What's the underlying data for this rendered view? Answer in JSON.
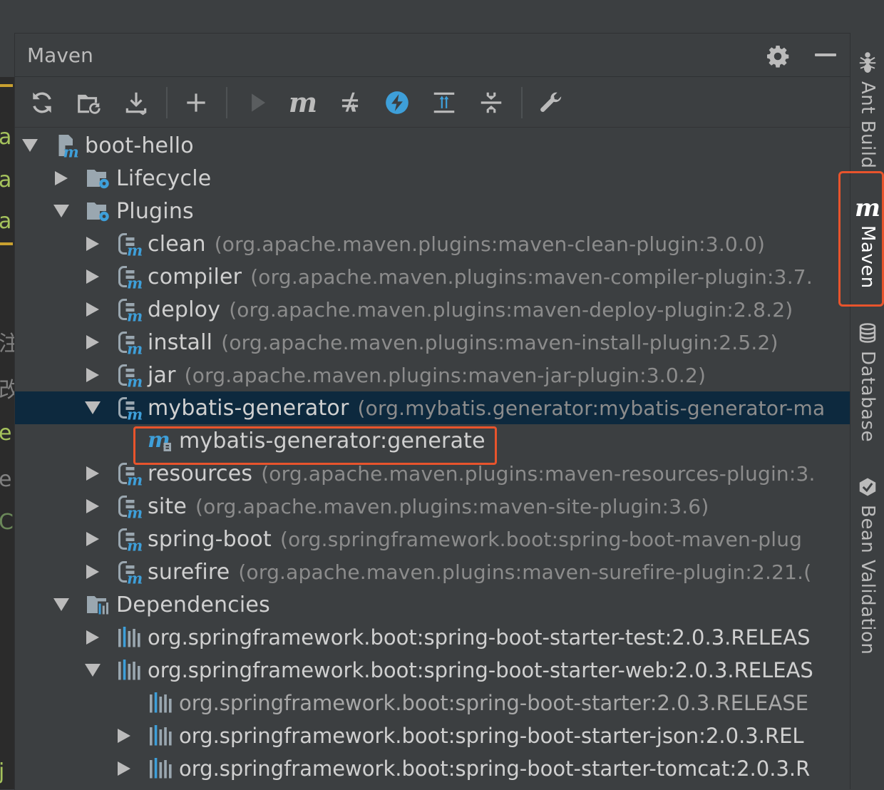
{
  "panel": {
    "title": "Maven"
  },
  "toolbar": {
    "buttons": [
      {
        "name": "reimport-icon"
      },
      {
        "name": "generate-sources-icon"
      },
      {
        "name": "download-icon"
      },
      {
        "name": "add-project-icon"
      },
      {
        "name": "run-icon"
      },
      {
        "name": "execute-goal-icon"
      },
      {
        "name": "toggle-offline-icon"
      },
      {
        "name": "skip-tests-icon"
      },
      {
        "name": "show-dependencies-icon"
      },
      {
        "name": "collapse-all-icon"
      },
      {
        "name": "settings-wrench-icon"
      }
    ],
    "execute_goal_glyph": "m"
  },
  "tree": {
    "root": "boot-hello",
    "lifecycle": "Lifecycle",
    "plugins_label": "Plugins",
    "plugins": [
      {
        "name": "clean",
        "coord": "(org.apache.maven.plugins:maven-clean-plugin:3.0.0)"
      },
      {
        "name": "compiler",
        "coord": "(org.apache.maven.plugins:maven-compiler-plugin:3.7."
      },
      {
        "name": "deploy",
        "coord": "(org.apache.maven.plugins:maven-deploy-plugin:2.8.2)"
      },
      {
        "name": "install",
        "coord": "(org.apache.maven.plugins:maven-install-plugin:2.5.2)"
      },
      {
        "name": "jar",
        "coord": "(org.apache.maven.plugins:maven-jar-plugin:3.0.2)"
      },
      {
        "name": "mybatis-generator",
        "coord": "(org.mybatis.generator:mybatis-generator-ma"
      },
      {
        "name": "resources",
        "coord": "(org.apache.maven.plugins:maven-resources-plugin:3."
      },
      {
        "name": "site",
        "coord": "(org.apache.maven.plugins:maven-site-plugin:3.6)"
      },
      {
        "name": "spring-boot",
        "coord": "(org.springframework.boot:spring-boot-maven-plug"
      },
      {
        "name": "surefire",
        "coord": "(org.apache.maven.plugins:maven-surefire-plugin:2.21.("
      }
    ],
    "goal": "mybatis-generator:generate",
    "dependencies_label": "Dependencies",
    "dependencies": [
      "org.springframework.boot:spring-boot-starter-test:2.0.3.RELEAS",
      "org.springframework.boot:spring-boot-starter-web:2.0.3.RELEAS",
      "org.springframework.boot:spring-boot-starter:2.0.3.RELEASE",
      "org.springframework.boot:spring-boot-starter-json:2.0.3.REL",
      "org.springframework.boot:spring-boot-starter-tomcat:2.0.3.R"
    ]
  },
  "side_tabs": {
    "ant_build": "Ant Build",
    "maven": "Maven",
    "maven_glyph": "m",
    "database": "Database",
    "bean_validation": "Bean Validation"
  },
  "editor_fragments": [
    "a",
    "a",
    "a",
    "注",
    "改",
    "e",
    "e",
    "C",
    "j"
  ],
  "colors": {
    "panel_bg": "#3c3f41",
    "selection": "#0d293e",
    "highlight_border": "#e8542c",
    "maven_blue": "#3e9fd9",
    "text": "#d0d0d0",
    "coord_text": "#8c8c8c"
  }
}
